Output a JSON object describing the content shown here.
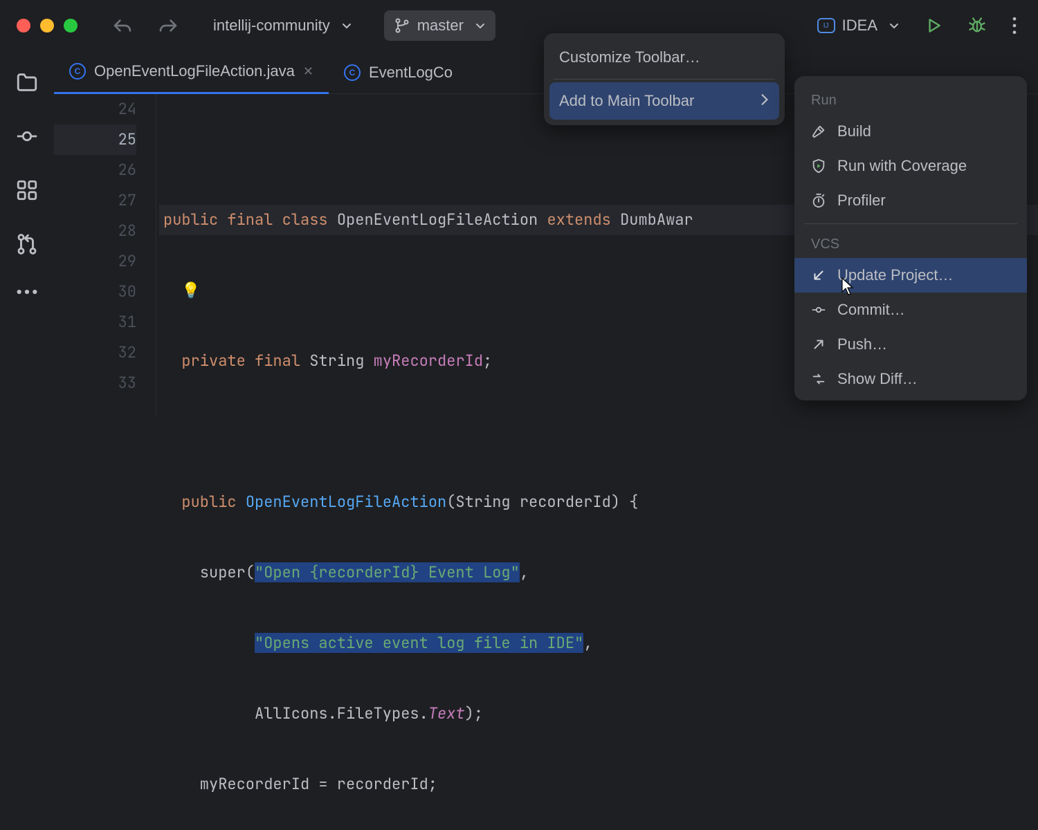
{
  "titlebar": {
    "project": "intellij-community",
    "branch": "master",
    "run_config": "IDEA"
  },
  "tabs": [
    {
      "name": "OpenEventLogFileAction.java",
      "active": true,
      "closable": true
    },
    {
      "name": "EventLogCo",
      "active": false,
      "closable": false
    }
  ],
  "gutter": {
    "start": 24,
    "end": 33,
    "current": 25
  },
  "code": {
    "l24": "",
    "l25_kw1": "public",
    "l25_kw2": "final",
    "l25_kw3": "class",
    "l25_cls": "OpenEventLogFileAction",
    "l25_kw4": "extends",
    "l25_sup": "DumbAwar",
    "l27_kw1": "private",
    "l27_kw2": "final",
    "l27_type": "String",
    "l27_name": "myRecorderId",
    "l27_end": ";",
    "l29_kw1": "public",
    "l29_name": "OpenEventLogFileAction",
    "l29_sig": "(String recorderId) {",
    "l30_pre": "    super(",
    "l30_str": "\"Open {recorderId} Event Log\"",
    "l30_end": ",",
    "l31_pre": "          ",
    "l31_str": "\"Opens active event log file in IDE\"",
    "l31_end": ",",
    "l32_pre": "          AllIcons.FileTypes.",
    "l32_it": "Text",
    "l32_end": ");",
    "l33": "    myRecorderId = recorderId;"
  },
  "popup1": {
    "customize": "Customize Toolbar…",
    "add": "Add to Main Toolbar"
  },
  "popup2": {
    "section_run": "Run",
    "build": "Build",
    "coverage": "Run with Coverage",
    "profiler": "Profiler",
    "section_vcs": "VCS",
    "update": "Update Project…",
    "commit": "Commit…",
    "push": "Push…",
    "diff": "Show Diff…"
  }
}
